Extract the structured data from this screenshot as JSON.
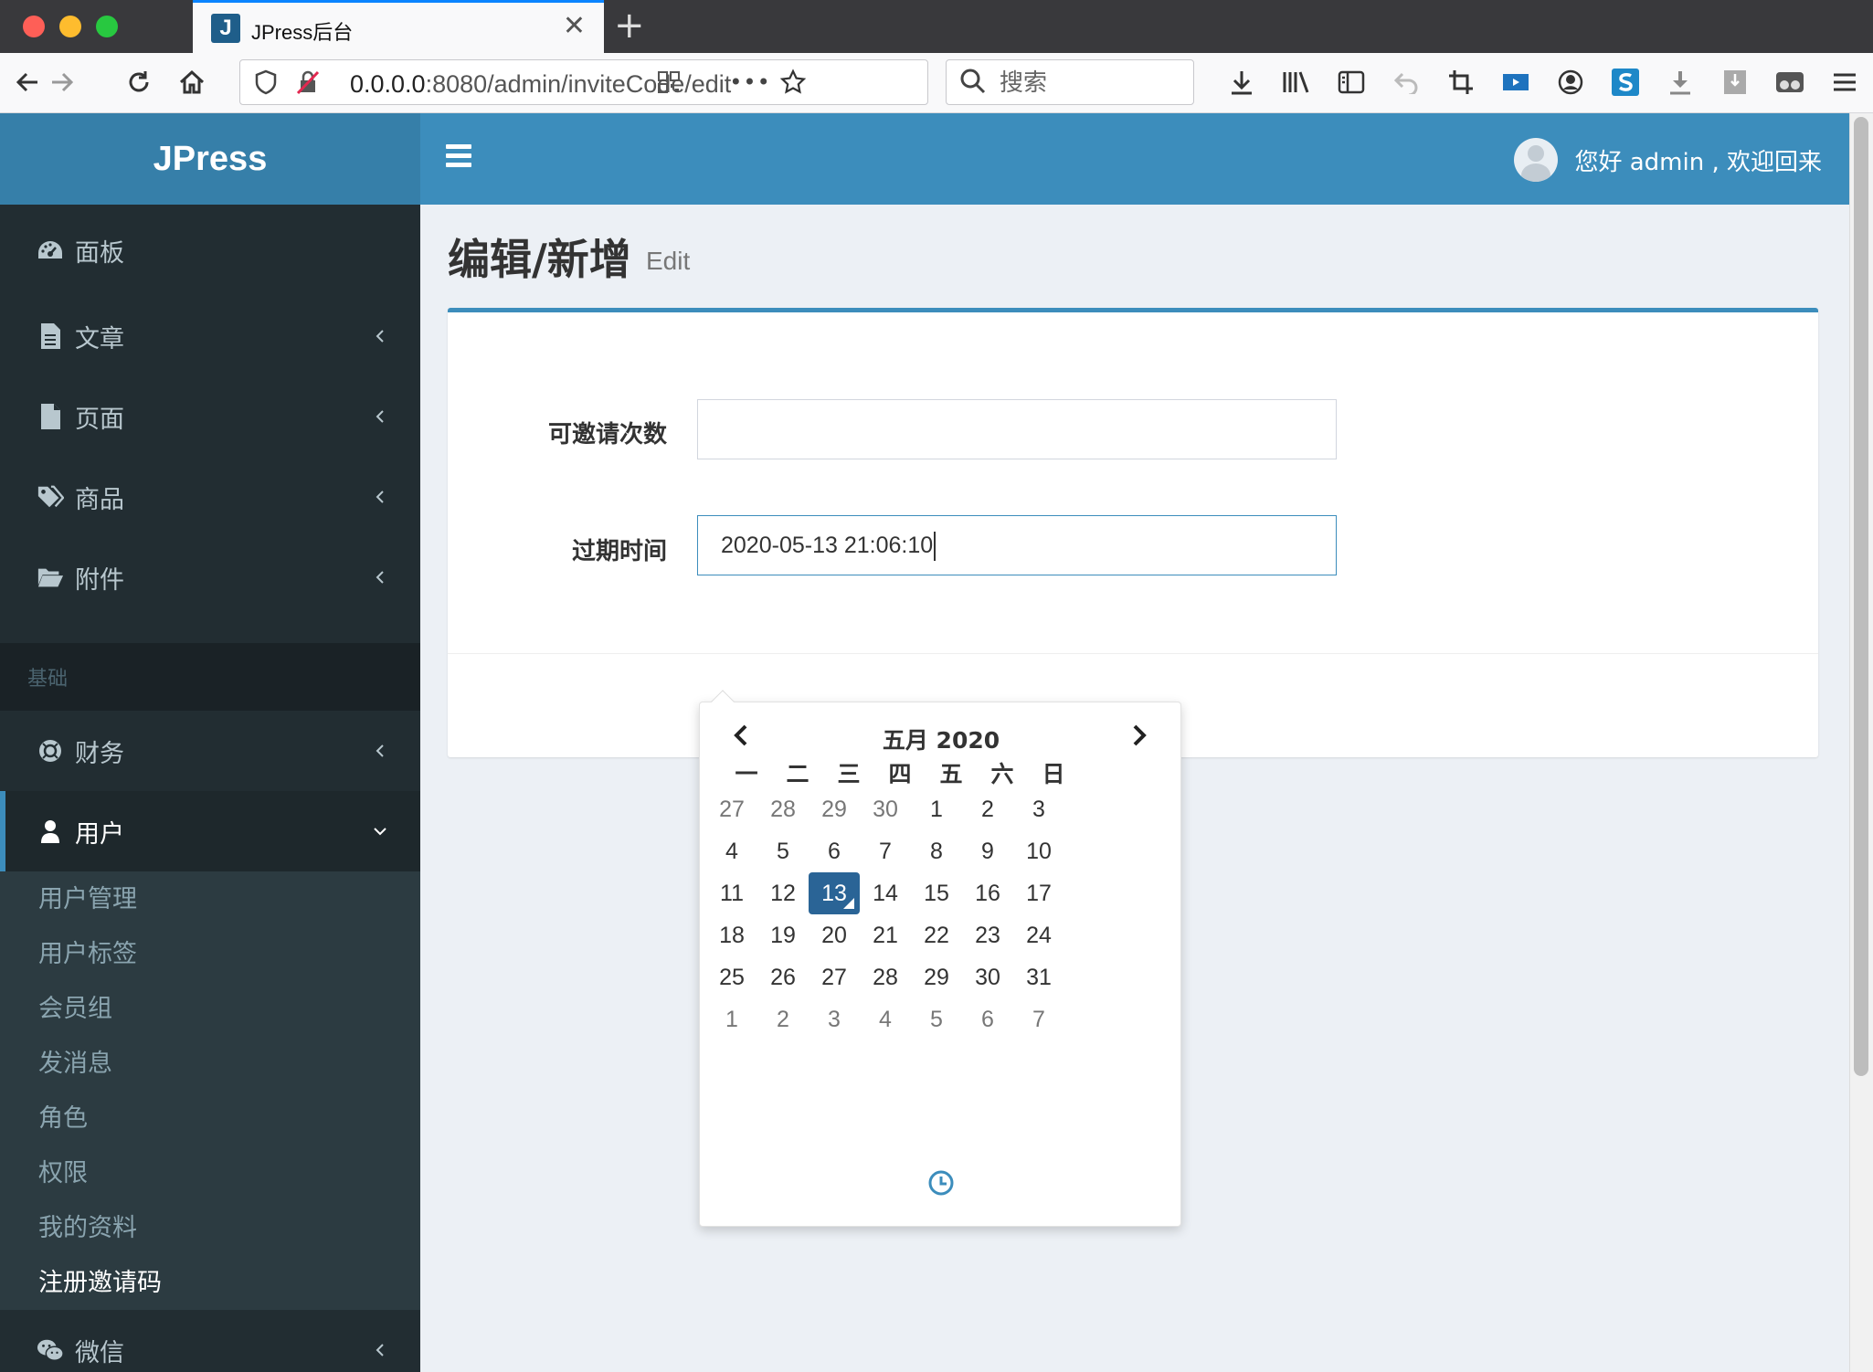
{
  "browser": {
    "tab_title": "JPress后台",
    "tab_favicon_letter": "J",
    "url_host": "0.0.0.0",
    "url_rest": ":8080/admin/inviteCode/edit",
    "search_placeholder": "搜索"
  },
  "app": {
    "logo": "JPress",
    "greeting": "您好 admin , 欢迎回来"
  },
  "sidebar": {
    "items": [
      {
        "label": "面板",
        "icon": "dashboard-icon"
      },
      {
        "label": "文章",
        "icon": "article-icon"
      },
      {
        "label": "页面",
        "icon": "page-icon"
      },
      {
        "label": "商品",
        "icon": "tags-icon"
      },
      {
        "label": "附件",
        "icon": "folder-icon"
      }
    ],
    "section_header": "基础",
    "finance": {
      "label": "财务",
      "icon": "finance-icon"
    },
    "user": {
      "label": "用户",
      "icon": "user-icon"
    },
    "submenu": [
      "用户管理",
      "用户标签",
      "会员组",
      "发消息",
      "角色",
      "权限",
      "我的资料",
      "注册邀请码"
    ],
    "wechat": {
      "label": "微信",
      "icon": "wechat-icon"
    }
  },
  "page": {
    "title": "编辑/新增",
    "subtitle": "Edit"
  },
  "form": {
    "invite_count_label": "可邀请次数",
    "invite_count_value": "",
    "expire_label": "过期时间",
    "expire_value": "2020-05-13 21:06:10"
  },
  "datepicker": {
    "month_title": "五月 2020",
    "weekdays": [
      "一",
      "二",
      "三",
      "四",
      "五",
      "六",
      "日"
    ],
    "weeks": [
      [
        "27",
        "28",
        "29",
        "30",
        "1",
        "2",
        "3"
      ],
      [
        "4",
        "5",
        "6",
        "7",
        "8",
        "9",
        "10"
      ],
      [
        "11",
        "12",
        "13",
        "14",
        "15",
        "16",
        "17"
      ],
      [
        "18",
        "19",
        "20",
        "21",
        "22",
        "23",
        "24"
      ],
      [
        "25",
        "26",
        "27",
        "28",
        "29",
        "30",
        "31"
      ],
      [
        "1",
        "2",
        "3",
        "4",
        "5",
        "6",
        "7"
      ]
    ],
    "selected": "13"
  },
  "colors": {
    "primary": "#3c8dbc",
    "logo_bg": "#367fa9",
    "sidebar_bg": "#222d32",
    "selected_day": "#2a6496"
  }
}
